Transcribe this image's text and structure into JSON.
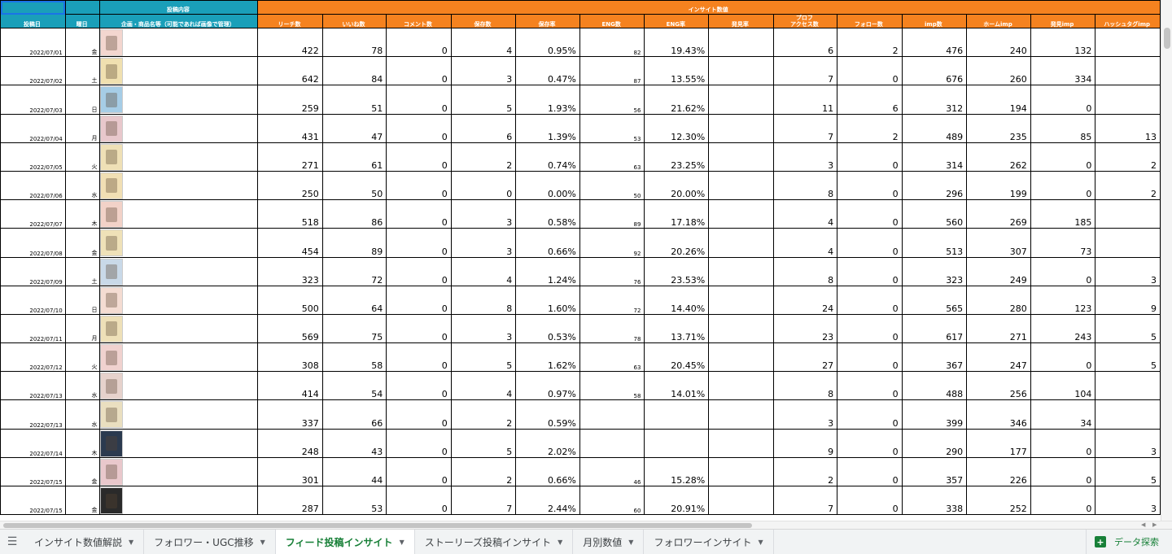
{
  "header": {
    "group_post": "投稿内容",
    "group_insight": "インサイト数値",
    "columns": [
      "投稿日",
      "曜日",
      "企画・商品名等（可能であれば画像で管理）",
      "リーチ数",
      "いいね数",
      "コメント数",
      "保存数",
      "保存率",
      "ENG数",
      "ENG率",
      "発見率",
      "プロフ\nアクセス数",
      "フォロー数",
      "imp数",
      "ホームimp",
      "発見imp",
      "ハッシュタグimp"
    ]
  },
  "rows": [
    {
      "date": "2022/07/01",
      "dow": "金",
      "thumb": "#f3d6cf",
      "reach": "422",
      "likes": "78",
      "comments": "0",
      "saves": "4",
      "save_rate": "0.95%",
      "eng": "82",
      "eng_rate": "19.43%",
      "discover": "",
      "prof": "6",
      "follow": "2",
      "imp": "476",
      "home": "240",
      "disc_imp": "132",
      "hash": ""
    },
    {
      "date": "2022/07/02",
      "dow": "土",
      "thumb": "#f0e0b0",
      "reach": "642",
      "likes": "84",
      "comments": "0",
      "saves": "3",
      "save_rate": "0.47%",
      "eng": "87",
      "eng_rate": "13.55%",
      "discover": "",
      "prof": "7",
      "follow": "0",
      "imp": "676",
      "home": "260",
      "disc_imp": "334",
      "hash": ""
    },
    {
      "date": "2022/07/03",
      "dow": "日",
      "thumb": "#a6cde6",
      "reach": "259",
      "likes": "51",
      "comments": "0",
      "saves": "5",
      "save_rate": "1.93%",
      "eng": "56",
      "eng_rate": "21.62%",
      "discover": "",
      "prof": "11",
      "follow": "6",
      "imp": "312",
      "home": "194",
      "disc_imp": "0",
      "hash": ""
    },
    {
      "date": "2022/07/04",
      "dow": "月",
      "thumb": "#e8c8cc",
      "reach": "431",
      "likes": "47",
      "comments": "0",
      "saves": "6",
      "save_rate": "1.39%",
      "eng": "53",
      "eng_rate": "12.30%",
      "discover": "",
      "prof": "7",
      "follow": "2",
      "imp": "489",
      "home": "235",
      "disc_imp": "85",
      "hash": "13"
    },
    {
      "date": "2022/07/05",
      "dow": "火",
      "thumb": "#efe0b6",
      "reach": "271",
      "likes": "61",
      "comments": "0",
      "saves": "2",
      "save_rate": "0.74%",
      "eng": "63",
      "eng_rate": "23.25%",
      "discover": "",
      "prof": "3",
      "follow": "0",
      "imp": "314",
      "home": "262",
      "disc_imp": "0",
      "hash": "2"
    },
    {
      "date": "2022/07/06",
      "dow": "水",
      "thumb": "#f1dfb4",
      "reach": "250",
      "likes": "50",
      "comments": "0",
      "saves": "0",
      "save_rate": "0.00%",
      "eng": "50",
      "eng_rate": "20.00%",
      "discover": "",
      "prof": "8",
      "follow": "0",
      "imp": "296",
      "home": "199",
      "disc_imp": "0",
      "hash": "2"
    },
    {
      "date": "2022/07/07",
      "dow": "木",
      "thumb": "#f2d2c8",
      "reach": "518",
      "likes": "86",
      "comments": "0",
      "saves": "3",
      "save_rate": "0.58%",
      "eng": "89",
      "eng_rate": "17.18%",
      "discover": "",
      "prof": "4",
      "follow": "0",
      "imp": "560",
      "home": "269",
      "disc_imp": "185",
      "hash": ""
    },
    {
      "date": "2022/07/08",
      "dow": "金",
      "thumb": "#efe1b8",
      "reach": "454",
      "likes": "89",
      "comments": "0",
      "saves": "3",
      "save_rate": "0.66%",
      "eng": "92",
      "eng_rate": "20.26%",
      "discover": "",
      "prof": "4",
      "follow": "0",
      "imp": "513",
      "home": "307",
      "disc_imp": "73",
      "hash": ""
    },
    {
      "date": "2022/07/09",
      "dow": "土",
      "thumb": "#c9d9e8",
      "reach": "323",
      "likes": "72",
      "comments": "0",
      "saves": "4",
      "save_rate": "1.24%",
      "eng": "76",
      "eng_rate": "23.53%",
      "discover": "",
      "prof": "8",
      "follow": "0",
      "imp": "323",
      "home": "249",
      "disc_imp": "0",
      "hash": "3"
    },
    {
      "date": "2022/07/10",
      "dow": "日",
      "thumb": "#f4dcd2",
      "reach": "500",
      "likes": "64",
      "comments": "0",
      "saves": "8",
      "save_rate": "1.60%",
      "eng": "72",
      "eng_rate": "14.40%",
      "discover": "",
      "prof": "24",
      "follow": "0",
      "imp": "565",
      "home": "280",
      "disc_imp": "123",
      "hash": "9"
    },
    {
      "date": "2022/07/11",
      "dow": "月",
      "thumb": "#eee0b8",
      "reach": "569",
      "likes": "75",
      "comments": "0",
      "saves": "3",
      "save_rate": "0.53%",
      "eng": "78",
      "eng_rate": "13.71%",
      "discover": "",
      "prof": "23",
      "follow": "0",
      "imp": "617",
      "home": "271",
      "disc_imp": "243",
      "hash": "5"
    },
    {
      "date": "2022/07/12",
      "dow": "火",
      "thumb": "#f0d2cf",
      "reach": "308",
      "likes": "58",
      "comments": "0",
      "saves": "5",
      "save_rate": "1.62%",
      "eng": "63",
      "eng_rate": "20.45%",
      "discover": "",
      "prof": "27",
      "follow": "0",
      "imp": "367",
      "home": "247",
      "disc_imp": "0",
      "hash": "5"
    },
    {
      "date": "2022/07/13",
      "dow": "水",
      "thumb": "#e6d2cc",
      "reach": "414",
      "likes": "54",
      "comments": "0",
      "saves": "4",
      "save_rate": "0.97%",
      "eng": "58",
      "eng_rate": "14.01%",
      "discover": "",
      "prof": "8",
      "follow": "0",
      "imp": "488",
      "home": "256",
      "disc_imp": "104",
      "hash": ""
    },
    {
      "date": "2022/07/13",
      "dow": "水",
      "thumb": "#eadfc0",
      "reach": "337",
      "likes": "66",
      "comments": "0",
      "saves": "2",
      "save_rate": "0.59%",
      "eng": "",
      "eng_rate": "",
      "discover": "",
      "prof": "3",
      "follow": "0",
      "imp": "399",
      "home": "346",
      "disc_imp": "34",
      "hash": ""
    },
    {
      "date": "2022/07/14",
      "dow": "木",
      "thumb": "#2b3a4f",
      "reach": "248",
      "likes": "43",
      "comments": "0",
      "saves": "5",
      "save_rate": "2.02%",
      "eng": "",
      "eng_rate": "",
      "discover": "",
      "prof": "9",
      "follow": "0",
      "imp": "290",
      "home": "177",
      "disc_imp": "0",
      "hash": "3"
    },
    {
      "date": "2022/07/15",
      "dow": "金",
      "thumb": "#e9c8cc",
      "reach": "301",
      "likes": "44",
      "comments": "0",
      "saves": "2",
      "save_rate": "0.66%",
      "eng": "46",
      "eng_rate": "15.28%",
      "discover": "",
      "prof": "2",
      "follow": "0",
      "imp": "357",
      "home": "226",
      "disc_imp": "0",
      "hash": "5"
    },
    {
      "date": "2022/07/15",
      "dow": "金",
      "thumb": "#2a2a2a",
      "reach": "287",
      "likes": "53",
      "comments": "0",
      "saves": "7",
      "save_rate": "2.44%",
      "eng": "60",
      "eng_rate": "20.91%",
      "discover": "",
      "prof": "7",
      "follow": "0",
      "imp": "338",
      "home": "252",
      "disc_imp": "0",
      "hash": "3"
    }
  ],
  "tabs": [
    {
      "label": "インサイト数値解説",
      "active": false
    },
    {
      "label": "フォロワー・UGC推移",
      "active": false
    },
    {
      "label": "フィード投稿インサイト",
      "active": true
    },
    {
      "label": "ストーリーズ投稿インサイト",
      "active": false
    },
    {
      "label": "月別数値",
      "active": false
    },
    {
      "label": "フォロワーインサイト",
      "active": false
    }
  ],
  "explore": {
    "label": "データ探索",
    "icon": "explore-icon"
  },
  "colors": {
    "teal": "#1a9fb9",
    "orange": "#f5821f",
    "active_tab": "#188038"
  }
}
